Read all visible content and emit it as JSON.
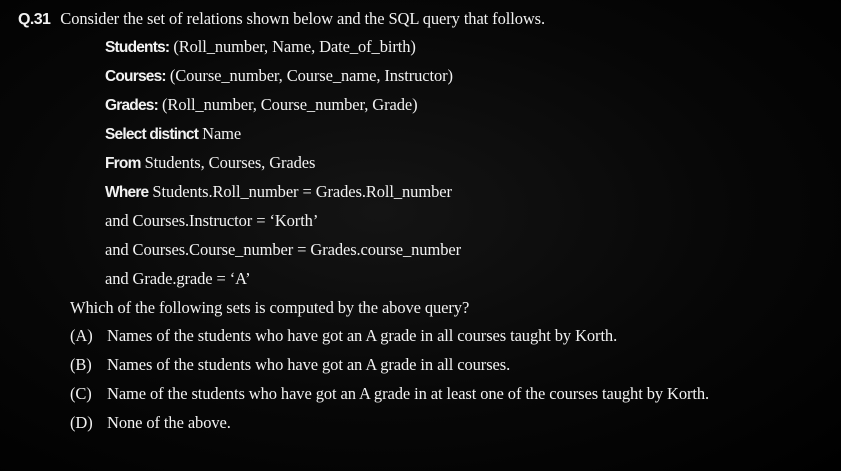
{
  "question": {
    "number": "Q.31",
    "prompt": "Consider the set of relations shown below and the SQL query that follows."
  },
  "relations": [
    {
      "name": "Students:",
      "attrs": "(Roll_number, Name, Date_of_birth)"
    },
    {
      "name": "Courses:",
      "attrs": "(Course_number, Course_name, Instructor)"
    },
    {
      "name": "Grades:",
      "attrs": "(Roll_number, Course_number, Grade)"
    }
  ],
  "query": [
    {
      "kw": "Select distinct",
      "text": "Name"
    },
    {
      "kw": "From",
      "text": "Students, Courses, Grades"
    },
    {
      "kw": "Where",
      "text": "Students.Roll_number = Grades.Roll_number"
    },
    {
      "kw": "",
      "text": "and Courses.Instructor = ‘Korth’"
    },
    {
      "kw": "",
      "text": "and Courses.Course_number = Grades.course_number"
    },
    {
      "kw": "",
      "text": "and Grade.grade = ‘A’"
    }
  ],
  "ask": "Which of the following sets is computed by the above query?",
  "options": [
    {
      "label": "(A)",
      "text": "Names of the students who have got an A grade in all courses taught by Korth."
    },
    {
      "label": "(B)",
      "text": "Names of the students who have got an A grade in all courses."
    },
    {
      "label": "(C)",
      "text": "Name of the students who have got an A grade in at least one of the courses taught by Korth."
    },
    {
      "label": "(D)",
      "text": "None of the above."
    }
  ]
}
